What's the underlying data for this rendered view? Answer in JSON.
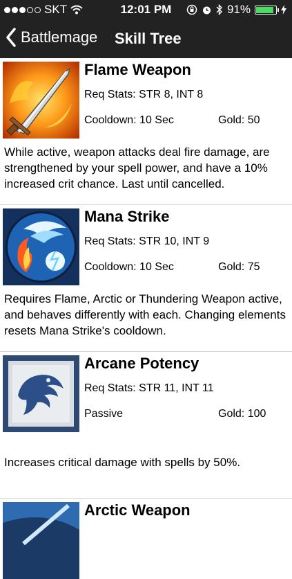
{
  "status": {
    "carrier": "SKT",
    "time": "12:01 PM",
    "battery": "91%",
    "battery_level": 0.91
  },
  "nav": {
    "back_label": "Battlemage",
    "title": "Skill Tree"
  },
  "skills": [
    {
      "name": "Flame Weapon",
      "req": "Req Stats: STR 8, INT 8",
      "cooldown": "Cooldown: 10 Sec",
      "gold": "Gold: 50",
      "description": "While active, weapon attacks deal fire damage, are strengthened by your spell power, and have a 10% increased crit chance. Last until cancelled.",
      "icon": "flame-sword-icon"
    },
    {
      "name": "Mana Strike",
      "req": "Req Stats: STR 10, INT 9",
      "cooldown": "Cooldown: 10 Sec",
      "gold": "Gold: 75",
      "description": "Requires Flame, Arctic or Thundering Weapon active, and behaves differently with each. Changing elements resets Mana Strike's cooldown.",
      "icon": "mana-strike-icon"
    },
    {
      "name": "Arcane Potency",
      "req": "Req Stats: STR 11, INT 11",
      "cooldown": "Passive",
      "gold": "Gold: 100",
      "description": "Increases critical damage with spells by 50%.",
      "icon": "arcane-potency-icon"
    },
    {
      "name": "Arctic Weapon",
      "icon": "arctic-weapon-icon"
    }
  ]
}
